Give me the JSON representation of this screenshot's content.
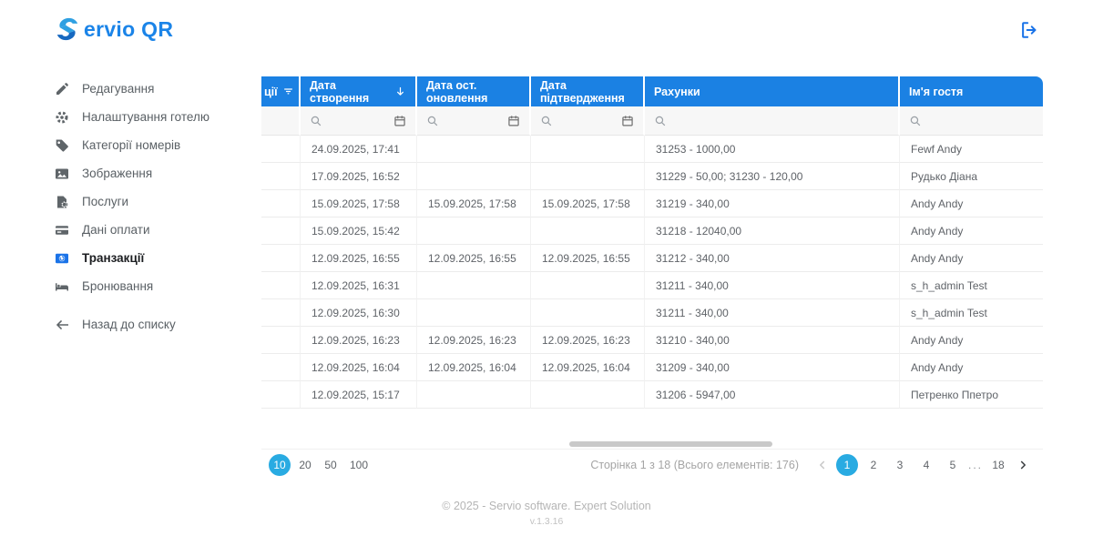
{
  "app": {
    "logo_text": "ervio QR",
    "footer_copyright": "© 2025 - Servio software. Expert Solution",
    "footer_version": "v.1.3.16"
  },
  "colors": {
    "header_blue": "#1b81e3",
    "active_circle_blue": "#29abe2",
    "link_blue": "#1a73e8"
  },
  "sidebar": {
    "items": [
      {
        "label": "Редагування",
        "icon": "pencil-icon",
        "active": false
      },
      {
        "label": "Налаштування готелю",
        "icon": "gear-icon",
        "active": false
      },
      {
        "label": "Категорії номерів",
        "icon": "tag-icon",
        "active": false
      },
      {
        "label": "Зображення",
        "icon": "image-icon",
        "active": false
      },
      {
        "label": "Послуги",
        "icon": "service-document-icon",
        "active": false
      },
      {
        "label": "Дані оплати",
        "icon": "credit-card-icon",
        "active": false
      },
      {
        "label": "Транзакції",
        "icon": "transactions-icon",
        "active": true
      },
      {
        "label": "Бронювання",
        "icon": "bed-icon",
        "active": false
      }
    ],
    "back_label": "Назад до списку"
  },
  "table": {
    "columns": [
      {
        "label": "ції"
      },
      {
        "label": "Дата створення"
      },
      {
        "label": "Дата ост. оновлення"
      },
      {
        "label": "Дата підтвердження"
      },
      {
        "label": "Рахунки"
      },
      {
        "label": "Ім'я гостя"
      }
    ],
    "sort_column": "Дата створення",
    "sort_direction": "desc",
    "rows": [
      [
        "",
        "24.09.2025, 17:41",
        "",
        "",
        "31253 - 1000,00",
        "Fewf Andy"
      ],
      [
        "",
        "17.09.2025, 16:52",
        "",
        "",
        "31229 - 50,00; 31230 - 120,00",
        "Рудько Діана"
      ],
      [
        "",
        "15.09.2025, 17:58",
        "15.09.2025, 17:58",
        "15.09.2025, 17:58",
        "31219 - 340,00",
        "Andy Andy"
      ],
      [
        "",
        "15.09.2025, 15:42",
        "",
        "",
        "31218 - 12040,00",
        "Andy Andy"
      ],
      [
        "",
        "12.09.2025, 16:55",
        "12.09.2025, 16:55",
        "12.09.2025, 16:55",
        "31212 - 340,00",
        "Andy Andy"
      ],
      [
        "",
        "12.09.2025, 16:31",
        "",
        "",
        "31211 - 340,00",
        "s_h_admin Test"
      ],
      [
        "",
        "12.09.2025, 16:30",
        "",
        "",
        "31211 - 340,00",
        "s_h_admin Test"
      ],
      [
        "",
        "12.09.2025, 16:23",
        "12.09.2025, 16:23",
        "12.09.2025, 16:23",
        "31210 - 340,00",
        "Andy Andy"
      ],
      [
        "",
        "12.09.2025, 16:04",
        "12.09.2025, 16:04",
        "12.09.2025, 16:04",
        "31209 - 340,00",
        "Andy Andy"
      ],
      [
        "",
        "12.09.2025, 15:17",
        "",
        "",
        "31206 - 5947,00",
        "Петренко Ппетро"
      ]
    ]
  },
  "pagination": {
    "page_sizes": [
      "10",
      "20",
      "50",
      "100"
    ],
    "active_size": "10",
    "info": "Сторінка 1 з 18 (Всього елементів: 176)",
    "pages": [
      "1",
      "2",
      "3",
      "4",
      "5",
      "...",
      "18"
    ],
    "active_page": "1"
  }
}
